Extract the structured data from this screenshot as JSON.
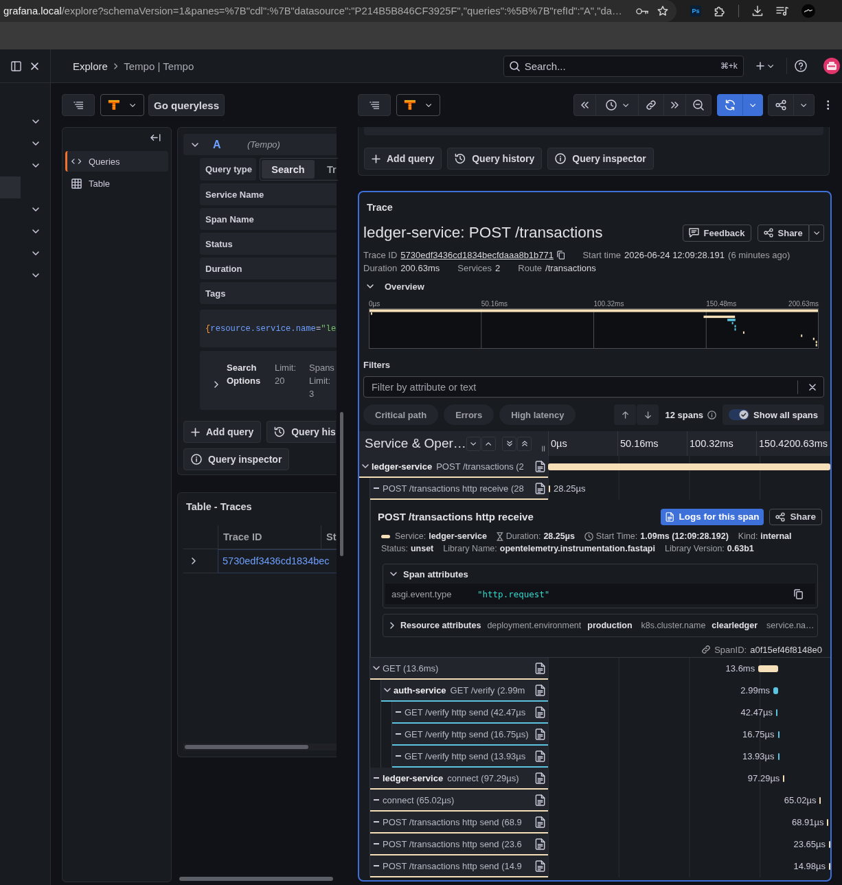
{
  "browser": {
    "url_host": "grafana.local",
    "url_path": "/explore?schemaVersion=1&panes=%7B\"cdl\":%7B\"datasource\":\"P214B5B846CF3925F\",\"queries\":%5B%7B\"refId\":\"A\",\"da…",
    "extension_label": "Ps"
  },
  "topbar": {
    "breadcrumbs": [
      "Explore",
      "Tempo | Tempo"
    ],
    "search": {
      "placeholder": "Search...",
      "shortcut": "⌘+k"
    }
  },
  "nav_items": [
    {
      "kind": "group",
      "selected": false
    },
    {
      "kind": "group",
      "selected": false
    },
    {
      "kind": "group",
      "selected": false
    },
    {
      "kind": "page",
      "selected": true
    },
    {
      "kind": "group",
      "selected": false
    },
    {
      "kind": "group",
      "selected": false
    },
    {
      "kind": "group",
      "selected": false
    },
    {
      "kind": "group",
      "selected": false
    }
  ],
  "left_pane": {
    "queryless_button": "Go queryless",
    "outline": [
      {
        "kind": "queries",
        "label": "Queries",
        "selected": true
      },
      {
        "kind": "table",
        "label": "Table",
        "selected": false
      }
    ],
    "query": {
      "ref": "A",
      "datasource": "(Tempo)",
      "expanded": true,
      "type_label": "Query type",
      "type_options": [
        {
          "label": "Search",
          "selected": true
        },
        {
          "label": "Tr",
          "selected": false
        }
      ],
      "fields": [
        "Service Name",
        "Span Name",
        "Status",
        "Duration",
        "Tags"
      ],
      "traceql": [
        {
          "kind": "brace",
          "text": "{"
        },
        {
          "kind": "attribute",
          "text": "resource.service.name"
        },
        {
          "kind": "operator",
          "text": "="
        },
        {
          "kind": "string",
          "text": "\"le"
        }
      ],
      "options": {
        "label": "Search Options",
        "expanded": false,
        "summary": [
          "Limit: 20",
          "Spans Limit: 3"
        ]
      }
    },
    "actions": [
      {
        "kind": "add",
        "label": "Add query"
      },
      {
        "kind": "history",
        "label": "Query his"
      },
      {
        "kind": "inspector",
        "label": "Query inspector"
      }
    ],
    "table": {
      "title": "Table - Traces",
      "columns": [
        "Trace ID",
        "St"
      ],
      "rows": [
        {
          "expanded": false,
          "cells": [
            "5730edf3436cd1834bec"
          ]
        }
      ]
    }
  },
  "right_pane": {
    "actions": [
      {
        "kind": "add",
        "label": "Add query"
      },
      {
        "kind": "history",
        "label": "Query history"
      },
      {
        "kind": "inspector",
        "label": "Query inspector"
      }
    ],
    "trace": {
      "panel_title": "Trace",
      "title": "ledger-service: POST /transactions",
      "buttons": [
        {
          "kind": "feedback",
          "label": "Feedback"
        },
        {
          "kind": "share",
          "label": "Share"
        }
      ],
      "meta": [
        [
          {
            "kind": "trace_id",
            "label": "Trace ID",
            "value": "5730edf3436cd1834becfdaaa8b1b771"
          },
          {
            "kind": "time",
            "label": "Start time",
            "value": "2026-06-24 12:09:28.191",
            "note": "(6 minutes ago)"
          }
        ],
        [
          {
            "kind": "plain",
            "label": "Duration",
            "value": "200.63ms"
          },
          {
            "kind": "plain",
            "label": "Services",
            "value": "2"
          },
          {
            "kind": "plain",
            "label": "Route",
            "value": "/transactions"
          }
        ]
      ],
      "overview": {
        "label": "Overview",
        "expanded": true,
        "ticks": [
          "0µs",
          "50.16ms",
          "100.32ms",
          "150.48ms",
          "200.63ms"
        ]
      },
      "filters": {
        "label": "Filters",
        "placeholder": "Filter by attribute or text",
        "chips": [
          "Critical path",
          "Errors",
          "High latency"
        ],
        "span_count": "12 spans",
        "show_all": {
          "label": "Show all spans",
          "on": true
        }
      },
      "timeline": {
        "column_title": "Service & Oper…",
        "ticks": [
          "0µs",
          "50.16ms",
          "100.32ms",
          "150.4",
          "200.63ms"
        ]
      },
      "spans": [
        {
          "service": "ledger-service",
          "operation": "POST /transactions (2",
          "color": "#f5dfb8",
          "expanded": true,
          "level": 1,
          "children": [
            {
              "operation": "POST /transactions http receive (28",
              "color": "#f5dfb8",
              "offset": {
                "level": 0.003
              },
              "level": 0.002,
              "duration": "28.25µs",
              "detail": {
                "title": "POST /transactions http receive",
                "buttons": [
                  {
                    "kind": "logs",
                    "label": "Logs for this span"
                  },
                  {
                    "kind": "share",
                    "label": "Share"
                  }
                ],
                "attributes": [
                  [
                    {
                      "kind": "service",
                      "label": "Service:",
                      "value": "ledger-service"
                    },
                    {
                      "kind": "duration",
                      "label": "Duration:",
                      "value": "28.25µs"
                    },
                    {
                      "kind": "start",
                      "label": "Start Time:",
                      "value": "1.09ms (12:09:28.192)"
                    },
                    {
                      "kind": "plain",
                      "label": "Kind:",
                      "value": "internal"
                    }
                  ],
                  [
                    {
                      "kind": "plain",
                      "label": "Status:",
                      "value": "unset"
                    },
                    {
                      "kind": "plain",
                      "label": "Library Name:",
                      "value": "opentelemetry.instrumentation.fastapi"
                    },
                    {
                      "kind": "plain",
                      "label": "Library Version:",
                      "value": "0.63b1"
                    }
                  ]
                ],
                "span_attributes": {
                  "label": "Span attributes",
                  "expanded": true,
                  "items": [
                    {
                      "key": "asgi.event.type",
                      "value": "\"http.request\""
                    }
                  ]
                },
                "resource_attributes": {
                  "label": "Resource attributes",
                  "expanded": false,
                  "items": [
                    {
                      "key": "deployment.environment",
                      "value": "production"
                    },
                    {
                      "key": "k8s.cluster.name",
                      "value": "clearledger"
                    },
                    {
                      "key": "service.na…"
                    }
                  ]
                },
                "span_id": {
                  "label": "SpanID:",
                  "value": "a0f15ef46f8148e0"
                }
              }
            },
            {
              "operation": "GET (13.6ms)",
              "color": "#f5dfb8",
              "expanded": true,
              "offset": {
                "level": 0.745
              },
              "level": 0.07,
              "duration": "13.6ms",
              "children": [
                {
                  "service": "auth-service",
                  "operation": "GET /verify (2.99m",
                  "color": "#5bc4e0",
                  "expanded": true,
                  "offset": {
                    "level": 0.798
                  },
                  "level": 0.018,
                  "duration": "2.99ms",
                  "children": [
                    {
                      "operation": "GET /verify http send (42.47µs",
                      "color": "#5bc4e0",
                      "offset": {
                        "level": 0.808
                      },
                      "level": 0.002,
                      "duration": "42.47µs"
                    },
                    {
                      "operation": "GET /verify http send (16.75µs)",
                      "color": "#5bc4e0",
                      "offset": {
                        "level": 0.814
                      },
                      "level": 0.002,
                      "duration": "16.75µs"
                    },
                    {
                      "operation": "GET /verify http send (13.93µs",
                      "color": "#5bc4e0",
                      "offset": {
                        "level": 0.814
                      },
                      "level": 0.002,
                      "duration": "13.93µs"
                    }
                  ]
                }
              ]
            },
            {
              "service": "ledger-service",
              "operation": "connect (97.29µs)",
              "color": "#f5dfb8",
              "offset": {
                "level": 0.833
              },
              "level": 0.002,
              "duration": "97.29µs"
            },
            {
              "operation": "connect (65.02µs)",
              "color": "#f5dfb8",
              "offset": {
                "level": 0.962
              },
              "level": 0.002,
              "duration": "65.02µs"
            },
            {
              "operation": "POST /transactions http send (68.9",
              "color": "#f5dfb8",
              "offset": {
                "level": 0.989
              },
              "level": 0.002,
              "duration": "68.91µs"
            },
            {
              "operation": "POST /transactions http send (23.6",
              "color": "#f5dfb8",
              "offset": {
                "level": 0.995
              },
              "level": 0.002,
              "duration": "23.65µs"
            },
            {
              "operation": "POST /transactions http send (14.9",
              "color": "#f5dfb8",
              "offset": {
                "level": 0.995
              },
              "level": 0.002,
              "duration": "14.98µs"
            }
          ]
        }
      ]
    }
  }
}
